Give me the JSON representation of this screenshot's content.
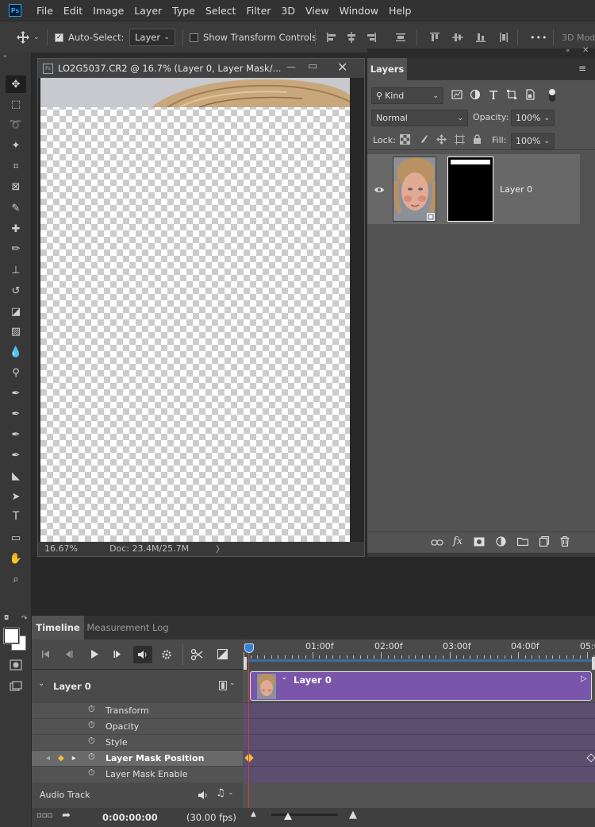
{
  "app": {
    "logo_text": "Ps"
  },
  "menu": [
    "File",
    "Edit",
    "Image",
    "Layer",
    "Type",
    "Select",
    "Filter",
    "3D",
    "View",
    "Window",
    "Help"
  ],
  "options": {
    "auto_select_label": "Auto-Select:",
    "auto_select_checked": true,
    "target_value": "Layer",
    "show_transform_label": "Show Transform Controls",
    "show_transform_checked": false,
    "more_label": "•••",
    "mode_3d_label": "3D Mod"
  },
  "tools": [
    "move-icon",
    "marquee-icon",
    "lasso-icon",
    "magic-wand-icon",
    "crop-icon",
    "frame-icon",
    "eyedropper-icon",
    "healing-icon",
    "brush-icon",
    "stamp-icon",
    "history-brush-icon",
    "eraser-icon",
    "gradient-icon",
    "blur-icon",
    "dodge-icon",
    "pen-icon",
    "freeform-pen-icon",
    "add-anchor-icon",
    "curvature-pen-icon",
    "path-select-icon",
    "direct-select-icon",
    "text-icon",
    "rectangle-icon",
    "hand-icon",
    "zoom-icon"
  ],
  "document": {
    "title": "LO2G5037.CR2 @ 16.7% (Layer 0, Layer Mask/...",
    "zoom": "16.67%",
    "doc_size": "Doc: 23.4M/25.7M",
    "status_arrow": "〉"
  },
  "layers_panel": {
    "tab_label": "Layers",
    "filter_kind": "Kind",
    "blend_mode": "Normal",
    "opacity_label": "Opacity:",
    "opacity_value": "100%",
    "lock_label": "Lock:",
    "fill_label": "Fill:",
    "fill_value": "100%",
    "layer_name": "Layer 0",
    "footer_icons": [
      "link-icon",
      "fx-icon",
      "add-mask-icon",
      "adjustment-icon",
      "group-folder-icon",
      "new-layer-icon",
      "trash-icon"
    ],
    "footer_fx": "fx"
  },
  "timeline": {
    "tab_timeline": "Timeline",
    "tab_measurement": "Measurement Log",
    "ruler_labels": [
      "01:00f",
      "02:00f",
      "03:00f",
      "04:00f",
      "05:0"
    ],
    "track_name": "Layer 0",
    "clip_name": "Layer 0",
    "properties": [
      "Transform",
      "Opacity",
      "Style",
      "Layer Mask Position",
      "Layer Mask Enable"
    ],
    "audio_track": "Audio Track",
    "current_time": "0:00:00:00",
    "fps": "(30.00 fps)"
  },
  "colors": {
    "menubar": "#323232",
    "panel": "#535353",
    "clip_purple": "#7a56ab",
    "track_purple": "#5b4e6e",
    "playhead": "#d43a3a",
    "keyframe": "#f0c23a",
    "accent_blue": "#2fa3f6"
  }
}
